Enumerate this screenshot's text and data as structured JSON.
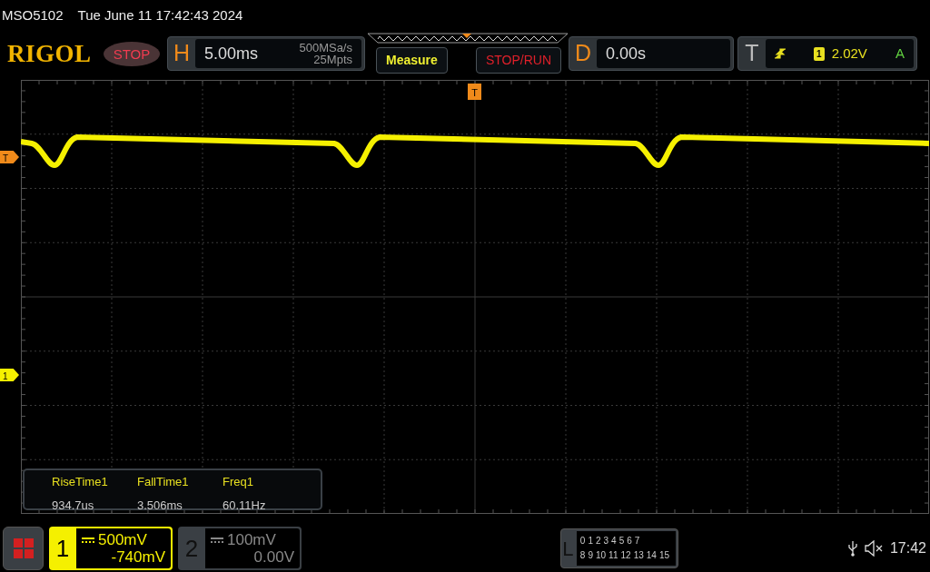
{
  "title_bar": {
    "model": "MSO5102",
    "datetime": "Tue June 11 17:42:43 2024"
  },
  "header": {
    "logo": "RIGOL",
    "run_state": "STOP",
    "horizontal": {
      "label": "H",
      "timebase": "5.00ms",
      "sample_rate": "500MSa/s",
      "memory_depth": "25Mpts"
    },
    "buttons": [
      "Measure",
      "STOP/RUN"
    ],
    "delay": {
      "label": "D",
      "value": "0.00s"
    },
    "trigger": {
      "label": "T",
      "source": "1",
      "level": "2.02V",
      "mode": "A"
    }
  },
  "screen": {
    "trigger_position_marker": "T",
    "trigger_level_marker": "T",
    "channel_marker": "1"
  },
  "measurements": [
    {
      "name": "RiseTime1",
      "value": "934.7us"
    },
    {
      "name": "FallTime1",
      "value": "3.506ms"
    },
    {
      "name": "Freq1",
      "value": "60.11Hz"
    }
  ],
  "channels": [
    {
      "number": "1",
      "scale": "500mV",
      "offset": "-740mV",
      "selected": true
    },
    {
      "number": "2",
      "scale": "100mV",
      "offset": "0.00V",
      "selected": false
    }
  ],
  "logic": {
    "label": "L",
    "row_1": [
      "0",
      "1",
      "2",
      "3",
      "4",
      "5",
      "6",
      "7"
    ],
    "row_2": [
      "8",
      "9",
      "10",
      "11",
      "12",
      "13",
      "14",
      "15"
    ]
  },
  "status": {
    "time": "17:42"
  }
}
